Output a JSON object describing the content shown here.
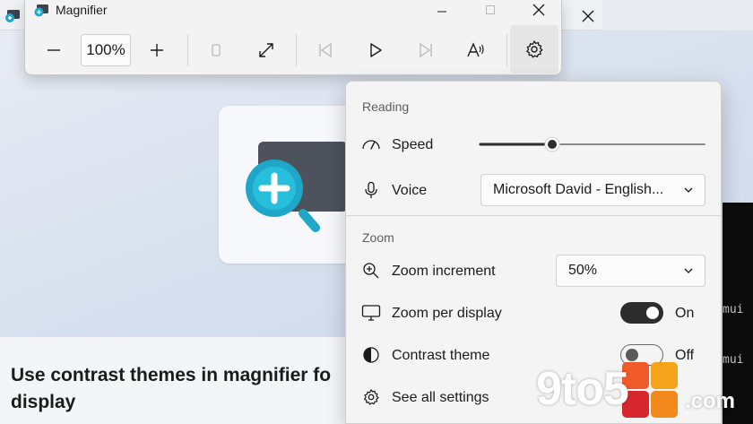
{
  "background_window": {
    "heading": "Use contrast themes in magnifier fo display",
    "terminal_lines": [
      "mui",
      "mui"
    ]
  },
  "magnifier": {
    "title": "Magnifier",
    "zoom_level": "100%",
    "icons": {
      "zoom_out": "minus-icon",
      "zoom_in": "plus-icon",
      "view": "view-mode-icon",
      "fullscreen": "expand-icon",
      "previous": "previous-icon",
      "play": "play-icon",
      "next": "next-icon",
      "read_from": "read-aloud-icon",
      "settings": "gear-icon"
    }
  },
  "settings_flyout": {
    "reading_section": "Reading",
    "speed_label": "Speed",
    "speed_value_fraction": 0.32,
    "voice_label": "Voice",
    "voice_value": "Microsoft David - English...",
    "zoom_section": "Zoom",
    "zoom_increment_label": "Zoom increment",
    "zoom_increment_value": "50%",
    "zoom_per_display_label": "Zoom per display",
    "zoom_per_display_state": "On",
    "contrast_theme_label": "Contrast theme",
    "contrast_theme_state": "Off",
    "see_all_settings_label": "See all settings"
  },
  "watermark": {
    "text": "9to5",
    "suffix": ".com"
  },
  "colors": {
    "accent_dark": "#2c2c2c",
    "magnifier_teal": "#1fa7c9",
    "watermark_orange": "#f28a1e"
  }
}
